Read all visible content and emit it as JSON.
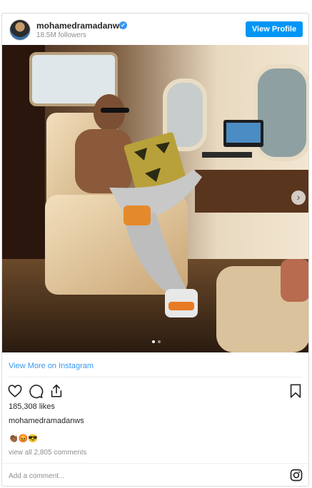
{
  "header": {
    "username": "mohamedramadanws",
    "verified_mark": "✓",
    "followers": "18.5M followers",
    "view_profile_label": "View Profile"
  },
  "photo": {
    "icon_next": "chevron-right-icon",
    "next_glyph": "›",
    "carousel_total": 2,
    "carousel_active": 1
  },
  "links": {
    "view_more": "View More on Instagram"
  },
  "actions": {
    "icons": [
      "heart-icon",
      "comment-icon",
      "share-icon",
      "bookmark-icon"
    ]
  },
  "post": {
    "likes": "185,308 likes",
    "caption_user": "mohamedramadanws",
    "emojis": "👏🏾😡😎",
    "view_comments": "view all 2,805 comments"
  },
  "comment_box": {
    "placeholder": "Add a comment...",
    "icon": "instagram-icon"
  },
  "colors": {
    "accent": "#0095f6",
    "link": "#3897f0",
    "muted": "#8e8e8e",
    "text": "#262626",
    "border": "#dbdbdb"
  }
}
